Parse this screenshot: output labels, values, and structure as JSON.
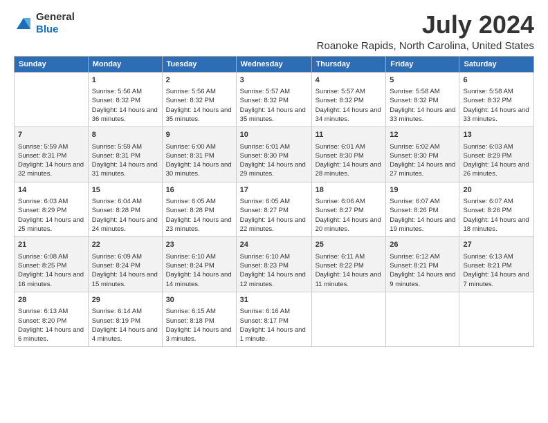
{
  "logo": {
    "general": "General",
    "blue": "Blue"
  },
  "title": "July 2024",
  "location": "Roanoke Rapids, North Carolina, United States",
  "days_of_week": [
    "Sunday",
    "Monday",
    "Tuesday",
    "Wednesday",
    "Thursday",
    "Friday",
    "Saturday"
  ],
  "weeks": [
    [
      {
        "day": "",
        "sunrise": "",
        "sunset": "",
        "daylight": ""
      },
      {
        "day": "1",
        "sunrise": "Sunrise: 5:56 AM",
        "sunset": "Sunset: 8:32 PM",
        "daylight": "Daylight: 14 hours and 36 minutes."
      },
      {
        "day": "2",
        "sunrise": "Sunrise: 5:56 AM",
        "sunset": "Sunset: 8:32 PM",
        "daylight": "Daylight: 14 hours and 35 minutes."
      },
      {
        "day": "3",
        "sunrise": "Sunrise: 5:57 AM",
        "sunset": "Sunset: 8:32 PM",
        "daylight": "Daylight: 14 hours and 35 minutes."
      },
      {
        "day": "4",
        "sunrise": "Sunrise: 5:57 AM",
        "sunset": "Sunset: 8:32 PM",
        "daylight": "Daylight: 14 hours and 34 minutes."
      },
      {
        "day": "5",
        "sunrise": "Sunrise: 5:58 AM",
        "sunset": "Sunset: 8:32 PM",
        "daylight": "Daylight: 14 hours and 33 minutes."
      },
      {
        "day": "6",
        "sunrise": "Sunrise: 5:58 AM",
        "sunset": "Sunset: 8:32 PM",
        "daylight": "Daylight: 14 hours and 33 minutes."
      }
    ],
    [
      {
        "day": "7",
        "sunrise": "Sunrise: 5:59 AM",
        "sunset": "Sunset: 8:31 PM",
        "daylight": "Daylight: 14 hours and 32 minutes."
      },
      {
        "day": "8",
        "sunrise": "Sunrise: 5:59 AM",
        "sunset": "Sunset: 8:31 PM",
        "daylight": "Daylight: 14 hours and 31 minutes."
      },
      {
        "day": "9",
        "sunrise": "Sunrise: 6:00 AM",
        "sunset": "Sunset: 8:31 PM",
        "daylight": "Daylight: 14 hours and 30 minutes."
      },
      {
        "day": "10",
        "sunrise": "Sunrise: 6:01 AM",
        "sunset": "Sunset: 8:30 PM",
        "daylight": "Daylight: 14 hours and 29 minutes."
      },
      {
        "day": "11",
        "sunrise": "Sunrise: 6:01 AM",
        "sunset": "Sunset: 8:30 PM",
        "daylight": "Daylight: 14 hours and 28 minutes."
      },
      {
        "day": "12",
        "sunrise": "Sunrise: 6:02 AM",
        "sunset": "Sunset: 8:30 PM",
        "daylight": "Daylight: 14 hours and 27 minutes."
      },
      {
        "day": "13",
        "sunrise": "Sunrise: 6:03 AM",
        "sunset": "Sunset: 8:29 PM",
        "daylight": "Daylight: 14 hours and 26 minutes."
      }
    ],
    [
      {
        "day": "14",
        "sunrise": "Sunrise: 6:03 AM",
        "sunset": "Sunset: 8:29 PM",
        "daylight": "Daylight: 14 hours and 25 minutes."
      },
      {
        "day": "15",
        "sunrise": "Sunrise: 6:04 AM",
        "sunset": "Sunset: 8:28 PM",
        "daylight": "Daylight: 14 hours and 24 minutes."
      },
      {
        "day": "16",
        "sunrise": "Sunrise: 6:05 AM",
        "sunset": "Sunset: 8:28 PM",
        "daylight": "Daylight: 14 hours and 23 minutes."
      },
      {
        "day": "17",
        "sunrise": "Sunrise: 6:05 AM",
        "sunset": "Sunset: 8:27 PM",
        "daylight": "Daylight: 14 hours and 22 minutes."
      },
      {
        "day": "18",
        "sunrise": "Sunrise: 6:06 AM",
        "sunset": "Sunset: 8:27 PM",
        "daylight": "Daylight: 14 hours and 20 minutes."
      },
      {
        "day": "19",
        "sunrise": "Sunrise: 6:07 AM",
        "sunset": "Sunset: 8:26 PM",
        "daylight": "Daylight: 14 hours and 19 minutes."
      },
      {
        "day": "20",
        "sunrise": "Sunrise: 6:07 AM",
        "sunset": "Sunset: 8:26 PM",
        "daylight": "Daylight: 14 hours and 18 minutes."
      }
    ],
    [
      {
        "day": "21",
        "sunrise": "Sunrise: 6:08 AM",
        "sunset": "Sunset: 8:25 PM",
        "daylight": "Daylight: 14 hours and 16 minutes."
      },
      {
        "day": "22",
        "sunrise": "Sunrise: 6:09 AM",
        "sunset": "Sunset: 8:24 PM",
        "daylight": "Daylight: 14 hours and 15 minutes."
      },
      {
        "day": "23",
        "sunrise": "Sunrise: 6:10 AM",
        "sunset": "Sunset: 8:24 PM",
        "daylight": "Daylight: 14 hours and 14 minutes."
      },
      {
        "day": "24",
        "sunrise": "Sunrise: 6:10 AM",
        "sunset": "Sunset: 8:23 PM",
        "daylight": "Daylight: 14 hours and 12 minutes."
      },
      {
        "day": "25",
        "sunrise": "Sunrise: 6:11 AM",
        "sunset": "Sunset: 8:22 PM",
        "daylight": "Daylight: 14 hours and 11 minutes."
      },
      {
        "day": "26",
        "sunrise": "Sunrise: 6:12 AM",
        "sunset": "Sunset: 8:21 PM",
        "daylight": "Daylight: 14 hours and 9 minutes."
      },
      {
        "day": "27",
        "sunrise": "Sunrise: 6:13 AM",
        "sunset": "Sunset: 8:21 PM",
        "daylight": "Daylight: 14 hours and 7 minutes."
      }
    ],
    [
      {
        "day": "28",
        "sunrise": "Sunrise: 6:13 AM",
        "sunset": "Sunset: 8:20 PM",
        "daylight": "Daylight: 14 hours and 6 minutes."
      },
      {
        "day": "29",
        "sunrise": "Sunrise: 6:14 AM",
        "sunset": "Sunset: 8:19 PM",
        "daylight": "Daylight: 14 hours and 4 minutes."
      },
      {
        "day": "30",
        "sunrise": "Sunrise: 6:15 AM",
        "sunset": "Sunset: 8:18 PM",
        "daylight": "Daylight: 14 hours and 3 minutes."
      },
      {
        "day": "31",
        "sunrise": "Sunrise: 6:16 AM",
        "sunset": "Sunset: 8:17 PM",
        "daylight": "Daylight: 14 hours and 1 minute."
      },
      {
        "day": "",
        "sunrise": "",
        "sunset": "",
        "daylight": ""
      },
      {
        "day": "",
        "sunrise": "",
        "sunset": "",
        "daylight": ""
      },
      {
        "day": "",
        "sunrise": "",
        "sunset": "",
        "daylight": ""
      }
    ]
  ]
}
